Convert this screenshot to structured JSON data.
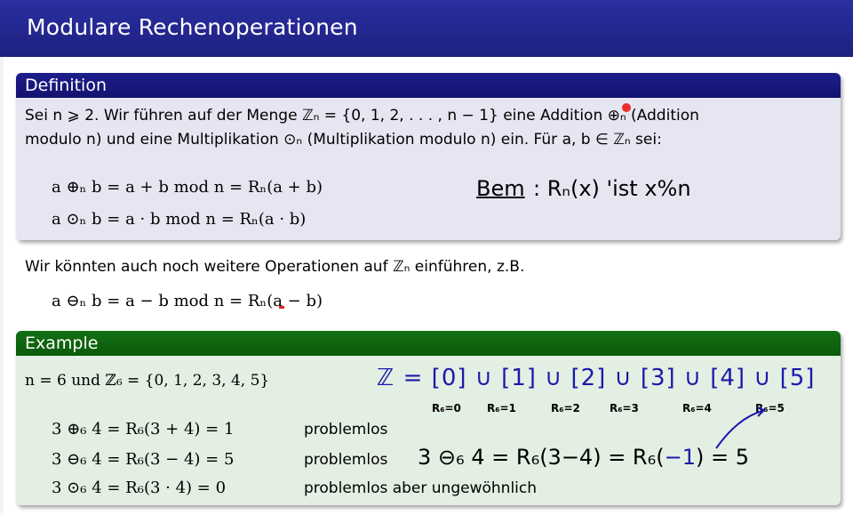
{
  "slide": {
    "title": "Modulare Rechenoperationen"
  },
  "definition": {
    "heading": "Definition",
    "line1": "Sei n ⩾ 2. Wir führen auf der Menge ℤₙ = {0, 1, 2, . . . , n − 1} eine Addition ⊕ₙ (Addition",
    "line2": "modulo n) und eine Multiplikation ⊙ₙ (Multiplikation modulo n) ein. Für a, b ∈ ℤₙ sei:",
    "formula1": "a ⊕ₙ b = a + b mod  n  =  Rₙ(a + b)",
    "formula2": "a ⊙ₙ b = a · b   mod  n  =  Rₙ(a · b)",
    "note_label": "Bem",
    "note_text": ":  Rₙ(x) 'ist  x%n"
  },
  "body": {
    "text": "Wir könnten auch noch weitere Operationen auf ℤₙ einführen, z.B.",
    "formula": "a ⊖ₙ b = a − b mod n  =  Rₙ(a − b)"
  },
  "example": {
    "heading": "Example",
    "intro": "n = 6 und ℤ₆ = {0, 1, 2, 3, 4, 5}",
    "rows": [
      {
        "formula": "3 ⊕₆ 4 = R₆(3 + 4)  =  1",
        "comment": "problemlos"
      },
      {
        "formula": "3 ⊖₆ 4 = R₆(3 − 4)  =  5",
        "comment": "problemlos"
      },
      {
        "formula": "3 ⊙₆ 4 = R₆(3 · 4)  =  0",
        "comment": "problemlos aber ungewöhnlich"
      }
    ],
    "hand_z": "ℤ = [0] ∪ [1] ∪ [2] ∪ [3] ∪ [4] ∪ [5]",
    "hand_braces": [
      "R₆=0",
      "R₆=1",
      "R₆=2",
      "R₆=3",
      "R₆=4",
      "R₆=5"
    ],
    "hand_calc": "3 ⊖₆ 4 = R₆(3−4) = R₆(",
    "hand_calc_neg": "−1",
    "hand_calc_end": ") = 5"
  }
}
